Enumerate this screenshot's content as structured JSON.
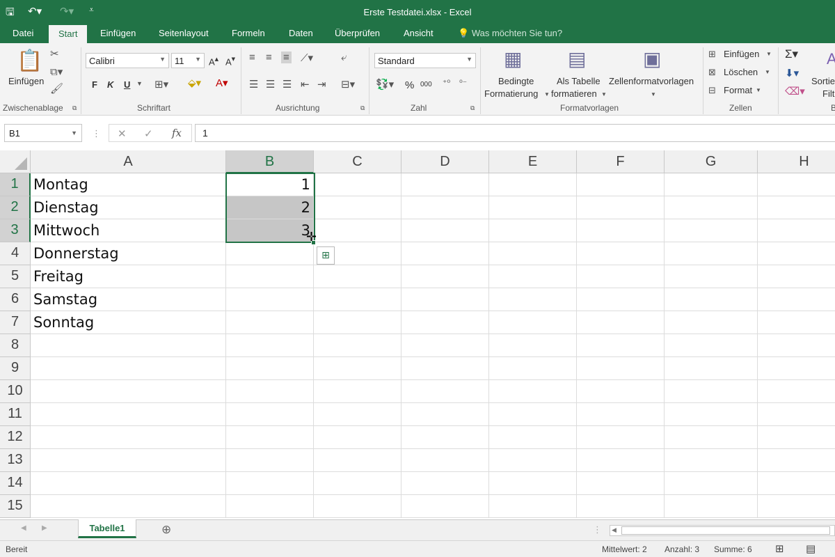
{
  "window": {
    "title": "Erste Testdatei.xlsx - Excel",
    "qa_save_icon": "save-icon",
    "qa_undo_icon": "undo-icon",
    "qa_redo_icon": "redo-icon",
    "qa_customize_icon": "customize-icon"
  },
  "tabs": [
    "Datei",
    "Start",
    "Einfügen",
    "Seitenlayout",
    "Formeln",
    "Daten",
    "Überprüfen",
    "Ansicht"
  ],
  "active_tab": "Start",
  "tell_me": "Was möchten Sie tun?",
  "ribbon": {
    "clipboard": {
      "paste": "Einfügen",
      "label": "Zwischenablage"
    },
    "font": {
      "name": "Calibri",
      "size": "11",
      "bold": "F",
      "italic": "K",
      "underline": "U",
      "label": "Schriftart"
    },
    "alignment": {
      "label": "Ausrichtung"
    },
    "number": {
      "format": "Standard",
      "percent": "%",
      "thousands": "000",
      "label": "Zahl"
    },
    "styles": {
      "conditional_1": "Bedingte",
      "conditional_2": "Formatierung",
      "table_1": "Als Tabelle",
      "table_2": "formatieren",
      "cell_styles": "Zellenformatvorlagen",
      "label": "Formatvorlagen"
    },
    "cells": {
      "insert": "Einfügen",
      "delete": "Löschen",
      "format": "Format",
      "label": "Zellen"
    },
    "editing": {
      "sort_1": "Sortie",
      "sort_2": "Filt",
      "label": "B"
    }
  },
  "formula_bar": {
    "name_box": "B1",
    "cancel": "✕",
    "enter": "✓",
    "fx": "fx",
    "value": "1"
  },
  "columns": [
    "A",
    "B",
    "C",
    "D",
    "E",
    "F",
    "G",
    "H"
  ],
  "rows": [
    "1",
    "2",
    "3",
    "4",
    "5",
    "6",
    "7",
    "8",
    "9",
    "10",
    "11",
    "12",
    "13",
    "14",
    "15"
  ],
  "cells": {
    "col_a": [
      "Montag",
      "Dienstag",
      "Mittwoch",
      "Donnerstag",
      "Freitag",
      "Samstag",
      "Sonntag"
    ],
    "col_b": [
      "1",
      "2",
      "3"
    ]
  },
  "selection": "B1:B3",
  "sheet_tab": "Tabelle1",
  "status": {
    "ready": "Bereit",
    "average": "Mittelwert: 2",
    "count": "Anzahl: 3",
    "sum": "Summe: 6"
  }
}
